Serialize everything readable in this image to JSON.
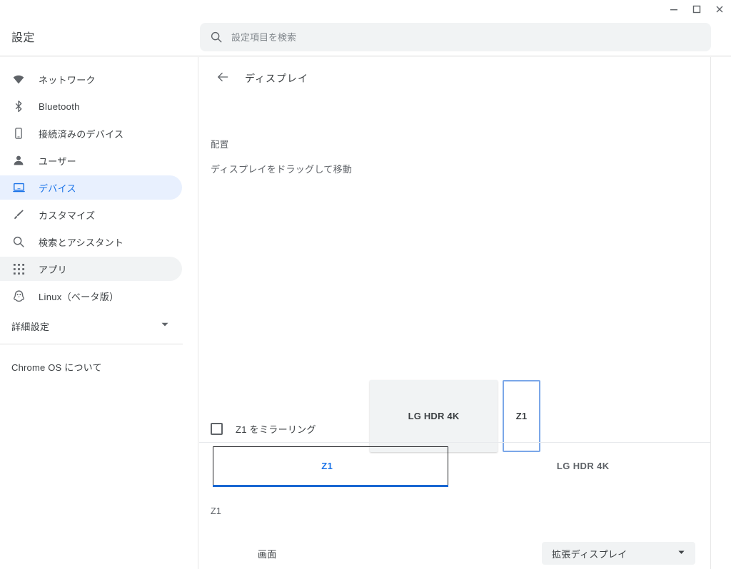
{
  "window": {
    "controls": [
      {
        "name": "minimize",
        "glyph": "minimize-icon"
      },
      {
        "name": "maximize",
        "glyph": "maximize-icon"
      },
      {
        "name": "close",
        "glyph": "close-icon"
      }
    ]
  },
  "header": {
    "app_title": "設定",
    "search": {
      "placeholder": "設定項目を検索",
      "value": "",
      "icon": "search-icon"
    }
  },
  "sidebar": {
    "items": [
      {
        "label": "ネットワーク",
        "icon": "wifi-icon",
        "state": "normal"
      },
      {
        "label": "Bluetooth",
        "icon": "bluetooth-icon",
        "state": "normal"
      },
      {
        "label": "接続済みのデバイス",
        "icon": "phone-icon",
        "state": "normal"
      },
      {
        "label": "ユーザー",
        "icon": "person-icon",
        "state": "normal"
      },
      {
        "label": "デバイス",
        "icon": "laptop-icon",
        "state": "selected"
      },
      {
        "label": "カスタマイズ",
        "icon": "brush-icon",
        "state": "normal"
      },
      {
        "label": "検索とアシスタント",
        "icon": "search-icon",
        "state": "normal"
      },
      {
        "label": "アプリ",
        "icon": "apps-grid-icon",
        "state": "hovered"
      },
      {
        "label": "Linux（ベータ版）",
        "icon": "penguin-icon",
        "state": "normal"
      }
    ],
    "advanced": {
      "label": "詳細設定",
      "icon": "chevron-down-icon"
    },
    "about": {
      "label": "Chrome OS について"
    }
  },
  "main": {
    "back_icon": "arrow-left-icon",
    "page_title": "ディスプレイ",
    "arrangement": {
      "section_label": "配置",
      "hint": "ディスプレイをドラッグして移動",
      "displays": [
        {
          "label": "LG HDR 4K",
          "selected": false
        },
        {
          "label": "Z1",
          "selected": true
        }
      ]
    },
    "mirror": {
      "label": "Z1 をミラーリング",
      "checked": false
    },
    "tabs": [
      {
        "label": "Z1",
        "active": true
      },
      {
        "label": "LG HDR 4K",
        "active": false
      }
    ],
    "display_section": {
      "title": "Z1",
      "rows": [
        {
          "name": "画面",
          "control": "select",
          "value": "拡張ディスプレイ",
          "arrow_icon": "dropdown-arrow-icon"
        }
      ]
    }
  },
  "colors": {
    "accent": "#1a73e8",
    "accent_dark": "#1967d2",
    "selected_bg": "#e8f0fe",
    "hover_bg": "#f1f3f4",
    "text": "#3c4043",
    "text_muted": "#5f6368",
    "display_border": "#7ba7e8"
  }
}
